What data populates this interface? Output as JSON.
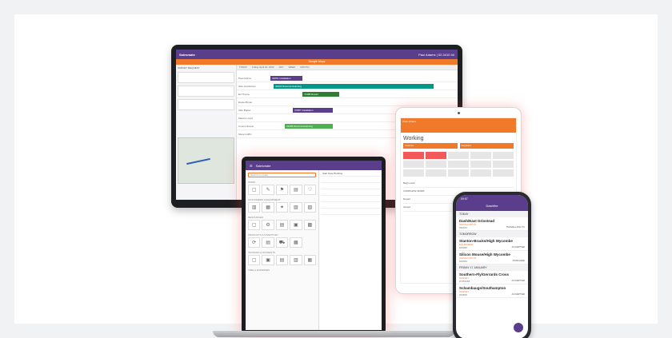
{
  "colors": {
    "purple": "#5a3e8c",
    "orange": "#f07a2a",
    "red": "#f25a5a"
  },
  "monitor": {
    "app_name": "Salesmate",
    "user": "Paul Adams | 02-3410 40",
    "banner": "Google Maps",
    "toolbar": [
      "TODAY",
      "Friday April 22, 2022",
      "DAY",
      "WEEK",
      "MONTH",
      "AGENDA",
      "TIMELINE"
    ],
    "side_title": "SURVEY REQUEST",
    "bars": [
      {
        "label": "32651 Installation",
        "color": "#5a3e8c"
      },
      {
        "label": "32022 Decommissioning",
        "color": "#009688"
      },
      {
        "label": "74388 Repair",
        "color": "#2e7d32"
      },
      {
        "label": "37887 Installation",
        "color": "#5a3e8c"
      },
      {
        "label": "31005 Decommissioning",
        "color": "#4caf50"
      }
    ],
    "rows": [
      "Paul Adams",
      "Glen Henderson",
      "Ed Thorne",
      "Daniel Bryan",
      "Alan Barker",
      "Maxine Lloyd",
      "Connor Evans",
      "Steve Griffin"
    ]
  },
  "laptop": {
    "app_name": "Salesmate",
    "search_placeholder": "Search to create",
    "sections": [
      "WORK",
      "CUSTOMERS & EQUIPMENT",
      "RESOURCES",
      "PRODUCTS & INVENTORY",
      "INVOICES & PAYMENTS",
      "TIME & EXPENSES"
    ],
    "columns": [
      "Start Date",
      "Building",
      "Address"
    ]
  },
  "tablet": {
    "header": "Work Orders",
    "title": "Working",
    "fields": [
      "Sources",
      "Suppliers"
    ],
    "list": [
      "Begin work",
      "COMPLETE WORK",
      "Depart",
      "Accept"
    ]
  },
  "phone": {
    "title": "Dashfire",
    "time": "09:57",
    "sections": [
      "TODAY",
      "TOMORROW",
      "FRIDAY 17 JANUARY"
    ],
    "items": [
      {
        "route": "Dash/East Grinstead",
        "category": "INSTALLATION",
        "number": "#30543",
        "status": "TRAVELLING TO"
      },
      {
        "route": "Stanton-Bracks/High Wycombe",
        "category": "EQUIPMENT",
        "number": "#29055",
        "status": "ACCEPTED"
      },
      {
        "route": "Silicon Mouse/High Wycombe",
        "category": "INSTALLATION",
        "number": "#29084",
        "status": "ASSIGNED"
      },
      {
        "route": "Southern-Fly/Gerrards Cross",
        "category": "SURVEY",
        "number": "#7254468",
        "status": "ACCEPTED"
      },
      {
        "route": "Schambaugs/Southampton",
        "category": "SURVEY",
        "number": "#33506",
        "status": "ACCEPTED"
      }
    ]
  }
}
